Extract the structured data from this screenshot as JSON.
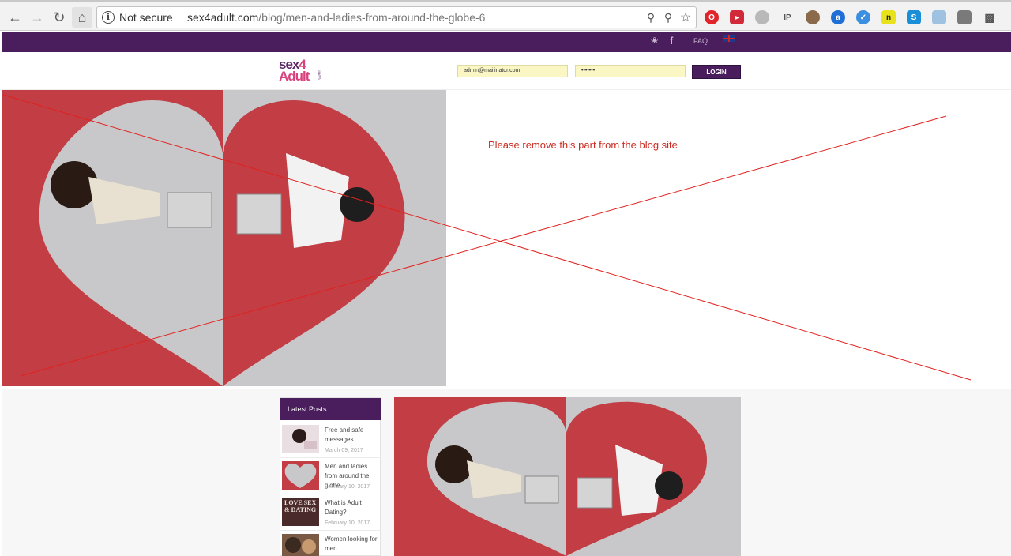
{
  "browser": {
    "security_label": "Not secure",
    "url_domain": "sex4adult.com",
    "url_path": "/blog/men-and-ladies-from-around-the-globe-6"
  },
  "topbar": {
    "faq": "FAQ",
    "language_flag": "uk-flag"
  },
  "header": {
    "logo_line1": "sex",
    "logo_four": "4",
    "logo_line2": "Adult",
    "logo_suffix": "com",
    "email_value": "admin@mailinator.com",
    "password_value": "•••••••",
    "login_label": "LOGIN"
  },
  "annotation": {
    "note": "Please remove this part from the blog site",
    "color": "#cc2b22"
  },
  "sidebar": {
    "title": "Latest Posts",
    "posts": [
      {
        "title": "Free and safe messages",
        "date": "March 09, 2017"
      },
      {
        "title": "Men and ladies from around the globe",
        "date": "February 10, 2017"
      },
      {
        "title": "What is Adult Dating?",
        "date": "February 10, 2017"
      },
      {
        "title": "Women looking for men",
        "date": ""
      }
    ]
  },
  "thumbs": {
    "thumb3_text": "LOVE SEX & DATING"
  },
  "colors": {
    "brand_purple": "#4a1d5c",
    "brand_pink": "#d9437d",
    "heart_red": "#c23d44"
  }
}
